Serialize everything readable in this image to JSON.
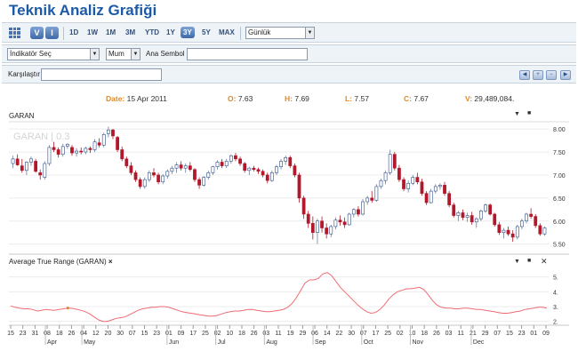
{
  "title": "Teknik Analiz Grafiği",
  "toolbar": {
    "view_v": "V",
    "view_i": "I",
    "ranges": [
      "1D",
      "1W",
      "1M",
      "3M",
      "YTD",
      "1Y",
      "3Y",
      "5Y",
      "MAX"
    ],
    "active_range": "3Y",
    "interval": "Günlük"
  },
  "controls": {
    "indicator_placeholder": "İndikatör Seç",
    "chart_type": "Mum",
    "main_symbol_label": "Ana Sembol",
    "compare_label": "Karşılaştır"
  },
  "info": {
    "date_label": "Date:",
    "date_value": "15 Apr 2011",
    "open_label": "O:",
    "open_value": "7.63",
    "high_label": "H:",
    "high_value": "7.69",
    "low_label": "L:",
    "low_value": "7.57",
    "close_label": "C:",
    "close_value": "7.67",
    "volume_label": "V:",
    "volume_value": "29,489,084."
  },
  "panels": {
    "price_label": "GARAN",
    "watermark": "GARAN | 0.3",
    "atr_label": "Average True Range (GARAN)"
  },
  "colors": {
    "up": "#ffffff",
    "up_border": "#2e4f8a",
    "down": "#b2182b",
    "doji": "#e08a2a",
    "atr": "#ef6b73",
    "grid": "#ececec"
  },
  "chart_data": [
    {
      "type": "candlestick",
      "title": "GARAN",
      "ylim": [
        5.3,
        8.1
      ],
      "yticks": [
        5.5,
        6.0,
        6.5,
        7.0,
        7.5,
        8.0
      ],
      "start_date": "2011-03-15",
      "candles": [
        [
          7.25,
          7.42,
          7.15,
          7.35
        ],
        [
          7.35,
          7.45,
          7.2,
          7.22
        ],
        [
          7.2,
          7.35,
          7.05,
          7.1
        ],
        [
          7.1,
          7.3,
          7.0,
          7.28
        ],
        [
          7.28,
          7.4,
          7.2,
          7.35
        ],
        [
          7.3,
          7.35,
          7.05,
          7.08
        ],
        [
          7.05,
          7.12,
          6.9,
          7.0
        ],
        [
          6.95,
          7.3,
          6.9,
          7.25
        ],
        [
          7.25,
          7.65,
          7.2,
          7.6
        ],
        [
          7.6,
          7.72,
          7.5,
          7.55
        ],
        [
          7.55,
          7.6,
          7.38,
          7.45
        ],
        [
          7.45,
          7.68,
          7.4,
          7.62
        ],
        [
          7.63,
          7.69,
          7.57,
          7.67
        ],
        [
          7.6,
          7.65,
          7.42,
          7.48
        ],
        [
          7.48,
          7.58,
          7.4,
          7.52
        ],
        [
          7.52,
          7.6,
          7.45,
          7.5
        ],
        [
          7.5,
          7.62,
          7.45,
          7.58
        ],
        [
          7.58,
          7.62,
          7.48,
          7.55
        ],
        [
          7.55,
          7.78,
          7.5,
          7.72
        ],
        [
          7.7,
          7.8,
          7.6,
          7.65
        ],
        [
          7.65,
          7.92,
          7.6,
          7.88
        ],
        [
          7.9,
          8.05,
          7.82,
          7.98
        ],
        [
          7.98,
          8.0,
          7.78,
          7.85
        ],
        [
          7.82,
          7.85,
          7.5,
          7.55
        ],
        [
          7.55,
          7.62,
          7.3,
          7.35
        ],
        [
          7.35,
          7.4,
          7.15,
          7.2
        ],
        [
          7.2,
          7.28,
          7.0,
          7.05
        ],
        [
          7.05,
          7.1,
          6.85,
          6.9
        ],
        [
          6.9,
          6.95,
          6.7,
          6.75
        ],
        [
          6.75,
          6.95,
          6.7,
          6.9
        ],
        [
          6.9,
          7.1,
          6.85,
          7.05
        ],
        [
          7.05,
          7.15,
          6.95,
          7.0
        ],
        [
          7.0,
          7.05,
          6.8,
          6.85
        ],
        [
          6.85,
          7.02,
          6.8,
          6.98
        ],
        [
          6.98,
          7.12,
          6.92,
          7.08
        ],
        [
          7.08,
          7.2,
          7.02,
          7.15
        ],
        [
          7.15,
          7.28,
          7.05,
          7.22
        ],
        [
          7.22,
          7.3,
          7.1,
          7.15
        ],
        [
          7.15,
          7.25,
          7.05,
          7.2
        ],
        [
          7.2,
          7.28,
          7.08,
          7.12
        ],
        [
          7.12,
          7.15,
          6.85,
          6.9
        ],
        [
          6.9,
          6.95,
          6.7,
          6.78
        ],
        [
          6.78,
          6.98,
          6.75,
          6.95
        ],
        [
          6.95,
          7.1,
          6.9,
          7.05
        ],
        [
          7.05,
          7.2,
          7.0,
          7.18
        ],
        [
          7.18,
          7.32,
          7.12,
          7.28
        ],
        [
          7.28,
          7.35,
          7.15,
          7.2
        ],
        [
          7.2,
          7.35,
          7.15,
          7.3
        ],
        [
          7.3,
          7.45,
          7.25,
          7.42
        ],
        [
          7.42,
          7.48,
          7.3,
          7.35
        ],
        [
          7.35,
          7.4,
          7.2,
          7.25
        ],
        [
          7.25,
          7.28,
          7.05,
          7.1
        ],
        [
          7.1,
          7.18,
          7.0,
          7.15
        ],
        [
          7.15,
          7.2,
          7.08,
          7.12
        ],
        [
          7.12,
          7.16,
          7.02,
          7.08
        ],
        [
          7.08,
          7.12,
          6.95,
          7.0
        ],
        [
          7.0,
          7.05,
          6.82,
          6.88
        ],
        [
          6.88,
          7.1,
          6.85,
          7.05
        ],
        [
          7.05,
          7.22,
          7.0,
          7.18
        ],
        [
          7.18,
          7.35,
          7.12,
          7.3
        ],
        [
          7.3,
          7.42,
          7.22,
          7.38
        ],
        [
          7.38,
          7.42,
          7.15,
          7.2
        ],
        [
          7.2,
          7.25,
          6.95,
          7.0
        ],
        [
          7.0,
          7.05,
          6.4,
          6.5
        ],
        [
          6.5,
          6.55,
          6.05,
          6.15
        ],
        [
          6.15,
          6.22,
          5.85,
          5.95
        ],
        [
          5.95,
          6.1,
          5.6,
          5.75
        ],
        [
          5.75,
          6.05,
          5.5,
          6.0
        ],
        [
          6.0,
          6.1,
          5.75,
          5.85
        ],
        [
          5.85,
          5.95,
          5.62,
          5.72
        ],
        [
          5.72,
          5.92,
          5.65,
          5.88
        ],
        [
          5.88,
          6.08,
          5.82,
          6.02
        ],
        [
          6.02,
          6.12,
          5.9,
          5.98
        ],
        [
          5.98,
          6.08,
          5.85,
          5.92
        ],
        [
          5.92,
          6.18,
          5.9,
          6.15
        ],
        [
          6.15,
          6.28,
          6.08,
          6.25
        ],
        [
          6.25,
          6.32,
          6.1,
          6.15
        ],
        [
          6.15,
          6.48,
          6.12,
          6.42
        ],
        [
          6.42,
          6.55,
          6.35,
          6.5
        ],
        [
          6.5,
          6.65,
          6.4,
          6.45
        ],
        [
          6.45,
          6.8,
          6.42,
          6.75
        ],
        [
          6.75,
          6.92,
          6.7,
          6.88
        ],
        [
          6.88,
          7.1,
          6.8,
          7.05
        ],
        [
          7.05,
          7.55,
          7.0,
          7.45
        ],
        [
          7.45,
          7.5,
          7.1,
          7.15
        ],
        [
          7.15,
          7.22,
          6.85,
          6.9
        ],
        [
          6.9,
          6.95,
          6.65,
          6.7
        ],
        [
          6.7,
          6.88,
          6.62,
          6.82
        ],
        [
          6.82,
          7.0,
          6.78,
          6.95
        ],
        [
          6.95,
          7.05,
          6.8,
          6.85
        ],
        [
          6.85,
          6.92,
          6.55,
          6.6
        ],
        [
          6.6,
          6.65,
          6.35,
          6.4
        ],
        [
          6.4,
          6.7,
          6.38,
          6.65
        ],
        [
          6.65,
          6.8,
          6.6,
          6.75
        ],
        [
          6.75,
          6.82,
          6.68,
          6.78
        ],
        [
          6.78,
          6.85,
          6.55,
          6.6
        ],
        [
          6.6,
          6.65,
          6.3,
          6.35
        ],
        [
          6.35,
          6.4,
          6.08,
          6.12
        ],
        [
          6.12,
          6.22,
          6.0,
          6.18
        ],
        [
          6.18,
          6.25,
          6.02,
          6.08
        ],
        [
          6.08,
          6.18,
          5.98,
          6.12
        ],
        [
          6.12,
          6.2,
          5.92,
          5.98
        ],
        [
          5.98,
          6.08,
          5.85,
          6.05
        ],
        [
          6.05,
          6.25,
          6.0,
          6.22
        ],
        [
          6.22,
          6.38,
          6.18,
          6.35
        ],
        [
          6.35,
          6.38,
          6.12,
          6.15
        ],
        [
          6.15,
          6.18,
          5.88,
          5.92
        ],
        [
          5.92,
          5.98,
          5.7,
          5.75
        ],
        [
          5.75,
          5.85,
          5.62,
          5.8
        ],
        [
          5.8,
          5.88,
          5.68,
          5.72
        ],
        [
          5.72,
          5.8,
          5.55,
          5.65
        ],
        [
          5.65,
          5.92,
          5.6,
          5.88
        ],
        [
          5.88,
          6.05,
          5.82,
          6.0
        ],
        [
          6.0,
          6.18,
          5.95,
          6.15
        ],
        [
          6.15,
          6.28,
          6.05,
          6.1
        ],
        [
          6.1,
          6.15,
          5.85,
          5.9
        ],
        [
          5.9,
          5.95,
          5.68,
          5.72
        ],
        [
          5.72,
          5.88,
          5.68,
          5.85
        ]
      ]
    },
    {
      "type": "line",
      "title": "Average True Range (GARAN)",
      "ylim": [
        1.8,
        5.7
      ],
      "yticks": [
        2,
        3,
        4,
        5
      ],
      "values": [
        3.05,
        2.95,
        2.9,
        2.85,
        2.85,
        2.8,
        2.7,
        2.75,
        2.8,
        2.78,
        2.75,
        2.8,
        2.85,
        2.9,
        2.88,
        2.82,
        2.75,
        2.65,
        2.5,
        2.3,
        2.1,
        2.0,
        2.0,
        2.1,
        2.2,
        2.25,
        2.3,
        2.45,
        2.6,
        2.75,
        2.85,
        2.9,
        2.95,
        2.95,
        3.0,
        3.0,
        2.95,
        2.85,
        2.75,
        2.65,
        2.6,
        2.55,
        2.5,
        2.45,
        2.4,
        2.35,
        2.35,
        2.4,
        2.5,
        2.6,
        2.65,
        2.7,
        2.7,
        2.75,
        2.8,
        2.8,
        2.75,
        2.7,
        2.65,
        2.65,
        2.7,
        2.75,
        2.8,
        2.95,
        3.2,
        3.6,
        4.1,
        4.6,
        4.8,
        4.8,
        4.9,
        5.2,
        5.3,
        5.1,
        4.7,
        4.3,
        4.0,
        3.7,
        3.4,
        3.1,
        2.85,
        2.65,
        2.55,
        2.6,
        2.8,
        3.1,
        3.5,
        3.8,
        4.0,
        4.1,
        4.2,
        4.2,
        4.25,
        4.3,
        4.15,
        3.8,
        3.4,
        3.1,
        2.95,
        2.9,
        2.9,
        2.85,
        2.85,
        2.9,
        2.9,
        2.85,
        2.8,
        2.8,
        2.75,
        2.7,
        2.65,
        2.6,
        2.55,
        2.55,
        2.6,
        2.65,
        2.7,
        2.8,
        2.85,
        2.9,
        2.95,
        2.95,
        2.9
      ]
    }
  ],
  "xaxis": {
    "day_ticks": [
      "15",
      "23",
      "31",
      "08",
      "18",
      "26",
      "04",
      "12",
      "20",
      "30",
      "07",
      "15",
      "23",
      "01",
      "09",
      "17",
      "25",
      "02",
      "10",
      "18",
      "26",
      "03",
      "11",
      "19",
      "29",
      "06",
      "14",
      "22",
      "30",
      "07",
      "17",
      "25",
      "02",
      "10",
      "18",
      "26",
      "03",
      "11",
      "21",
      "29",
      "07",
      "15",
      "23",
      "01",
      "09"
    ],
    "month_ticks": [
      "Apr",
      "May",
      "Jun",
      "Jul",
      "Aug",
      "Sep",
      "Oct",
      "Nov",
      "Dec"
    ]
  }
}
